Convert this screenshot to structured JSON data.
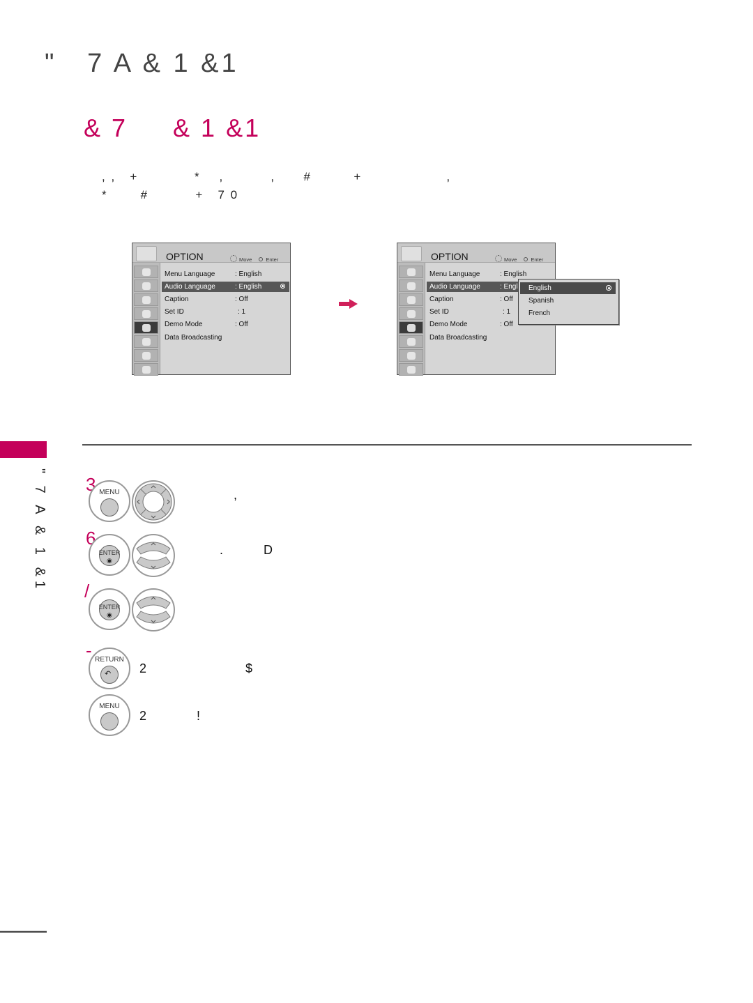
{
  "page": {
    "chapter_title": "\"   7 A & 1 &1",
    "section_title": "& 7     & 1 &1",
    "intro_lines": [
      ", ,   +            *    ,          ,      #         +                  ,",
      "*       #          +   7 0"
    ],
    "side_tab_text": "\" 7 A & 1 &1",
    "accent_color": "#c4005a"
  },
  "menus": [
    {
      "title": "OPTION",
      "hint_move": "Move",
      "hint_enter": "Enter",
      "sidebar_icons": [
        "picture-icon",
        "screen-icon",
        "audio-icon",
        "time-icon",
        "option-icon",
        "lock-icon",
        "input-icon",
        "usb-icon"
      ],
      "selected_sidebar_index": 4,
      "items": [
        {
          "label": "Menu Language",
          "value": ": English"
        },
        {
          "label": "Audio Language",
          "value": ": English",
          "selected": true
        },
        {
          "label": "Caption",
          "value": ": Off"
        },
        {
          "label": "Set ID",
          "value": ": 1"
        },
        {
          "label": "Demo Mode",
          "value": ": Off"
        },
        {
          "label": "Data Broadcasting",
          "value": ""
        }
      ]
    },
    {
      "title": "OPTION",
      "hint_move": "Move",
      "hint_enter": "Enter",
      "sidebar_icons": [
        "picture-icon",
        "screen-icon",
        "audio-icon",
        "time-icon",
        "option-icon",
        "lock-icon",
        "input-icon",
        "usb-icon"
      ],
      "selected_sidebar_index": 4,
      "items": [
        {
          "label": "Menu Language",
          "value": ": English"
        },
        {
          "label": "Audio Language",
          "value": ": Engl",
          "selected": true
        },
        {
          "label": "Caption",
          "value": ": Off"
        },
        {
          "label": "Set ID",
          "value": ": 1"
        },
        {
          "label": "Demo Mode",
          "value": ": Off"
        },
        {
          "label": "Data Broadcasting",
          "value": ""
        }
      ],
      "popup_options": [
        {
          "label": "English",
          "selected": true
        },
        {
          "label": "Spanish"
        },
        {
          "label": "French"
        }
      ]
    }
  ],
  "steps": [
    {
      "number": "3",
      "button": "MENU",
      "text": "          ,"
    },
    {
      "number": "6",
      "button": "ENTER",
      "text": ".        D"
    },
    {
      "number": "/",
      "button": "ENTER",
      "text": ""
    },
    {
      "number": "-",
      "button": "RETURN",
      "text": "2                    $"
    },
    {
      "number": "",
      "button": "MENU",
      "text": "2          !"
    }
  ]
}
